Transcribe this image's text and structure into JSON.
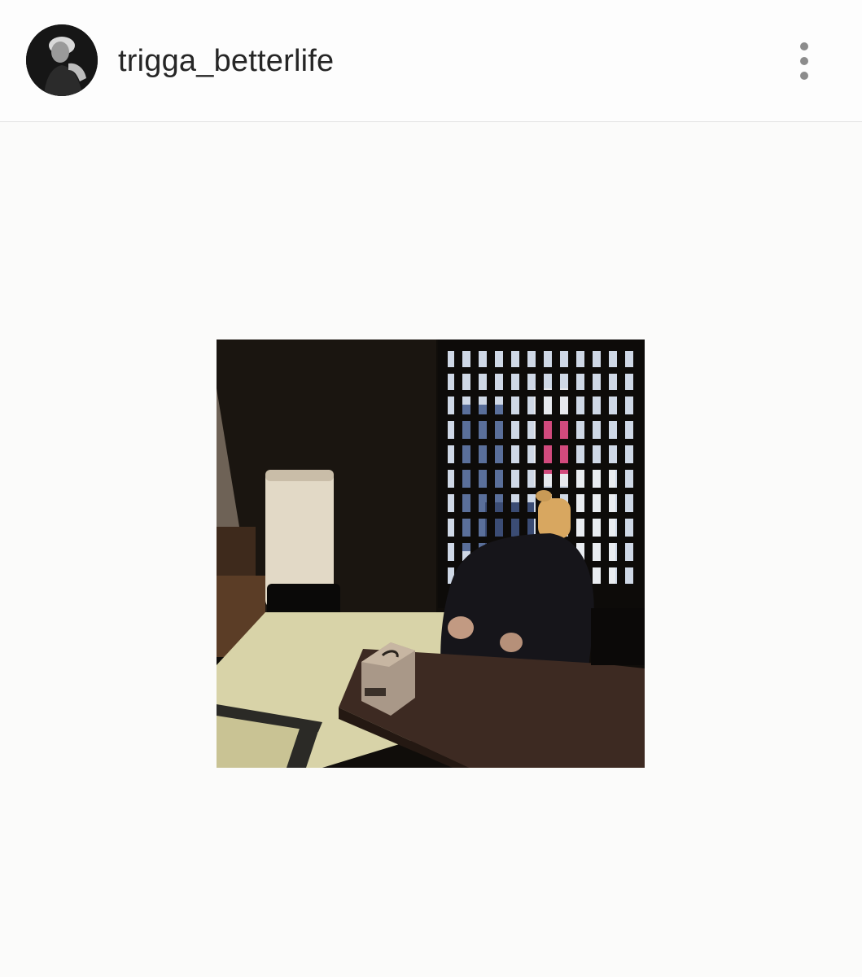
{
  "header": {
    "username": "trigga_betterlife",
    "avatar_icon": "profile-avatar",
    "more_icon": "more-vertical-icon"
  },
  "post": {
    "image_icon": "post-photo"
  },
  "colors": {
    "background": "#fbfbfa",
    "username_text": "#262626",
    "menu_dots": "#8c8c8c",
    "divider": "#e2e2e2"
  }
}
